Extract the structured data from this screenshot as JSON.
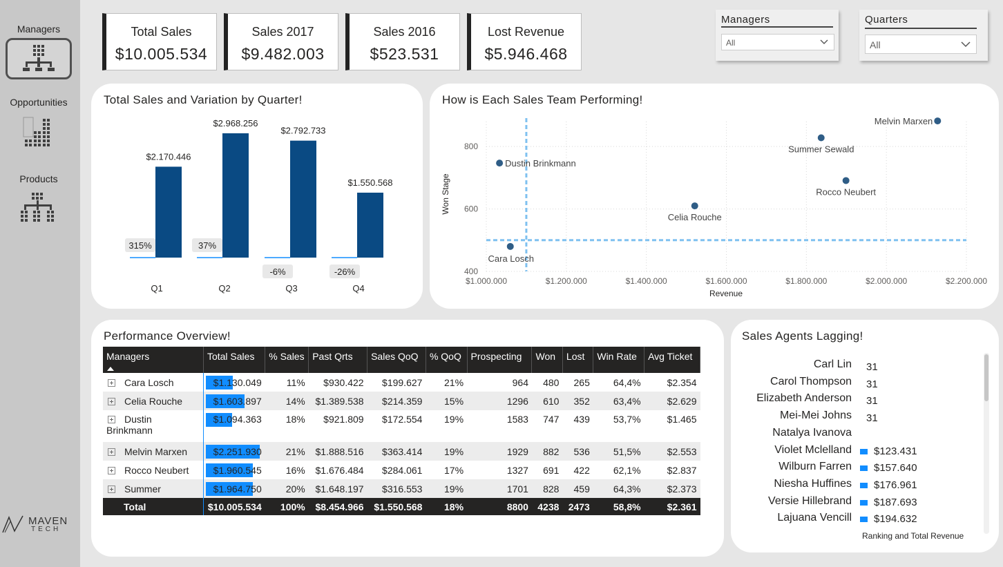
{
  "sidebar": {
    "items": [
      {
        "label": "Managers",
        "icon": "org-grid-icon",
        "active": true
      },
      {
        "label": "Opportunities",
        "icon": "bar-grid-icon",
        "active": false
      },
      {
        "label": "Products",
        "icon": "hierarchy-grid-icon",
        "active": false
      }
    ],
    "logo_text": "MAVEN",
    "logo_sub": "TECH"
  },
  "kpis": [
    {
      "title": "Total Sales",
      "value": "$10.005.534"
    },
    {
      "title": "Sales 2017",
      "value": "$9.482.003"
    },
    {
      "title": "Sales 2016",
      "value": "$523.531"
    },
    {
      "title": "Lost Revenue",
      "value": "$5.946.468"
    }
  ],
  "slicers": {
    "managers": {
      "title": "Managers",
      "value": "All"
    },
    "quarters": {
      "title": "Quarters",
      "value": "All"
    }
  },
  "colors": {
    "bar_dark": "#0a4a83",
    "accent_blue": "#118dff",
    "dot": "#2f5d86",
    "ref_line": "#7fc1f0"
  },
  "bar_panel": {
    "title": "Total Sales and Variation by Quarter!",
    "chart_data": {
      "type": "bar",
      "categories": [
        "Q1",
        "Q2",
        "Q3",
        "Q4"
      ],
      "values": [
        2170446,
        2968256,
        2792733,
        1550568
      ],
      "value_labels": [
        "$2.170.446",
        "$2.968.256",
        "$2.792.733",
        "$1.550.568"
      ],
      "variation": [
        315,
        37,
        -6,
        -26
      ],
      "variation_labels": [
        "315%",
        "37%",
        "-6%",
        "-26%"
      ],
      "ylim": [
        0,
        2968256
      ]
    }
  },
  "scatter_panel": {
    "title": "How is Each Sales Team Performing!",
    "chart_data": {
      "type": "scatter",
      "xlabel": "Revenue",
      "ylabel": "Won Stage",
      "xlim": [
        1000000,
        2200000
      ],
      "ylim": [
        400,
        880
      ],
      "x_ticks": [
        1000000,
        1200000,
        1400000,
        1600000,
        1800000,
        2000000,
        2200000
      ],
      "x_tick_labels": [
        "$1.000.000",
        "$1.200.000",
        "$1.400.000",
        "$1.600.000",
        "$1.800.000",
        "$2.000.000",
        "$2.200.000"
      ],
      "y_ticks": [
        400,
        600,
        800
      ],
      "y_tick_labels": [
        "400",
        "600",
        "800"
      ],
      "points": [
        {
          "label": "Cara Losch",
          "x": 1060000,
          "y": 480
        },
        {
          "label": "Dustin Brinkmann",
          "x": 1033000,
          "y": 747
        },
        {
          "label": "Celia Rouche",
          "x": 1521000,
          "y": 610
        },
        {
          "label": "Summer Sewald",
          "x": 1837000,
          "y": 828
        },
        {
          "label": "Rocco Neubert",
          "x": 1899000,
          "y": 691
        },
        {
          "label": "Melvin Marxen",
          "x": 2128000,
          "y": 882
        }
      ],
      "ref_x": 1100000,
      "ref_y": 500
    }
  },
  "table_panel": {
    "title": "Performance Overview!",
    "headers": [
      "Managers",
      "Total Sales",
      "% Sales",
      "Past Qrts",
      "Sales QoQ",
      "% QoQ",
      "Prospecting",
      "Won",
      "Lost",
      "Win Rate",
      "Avg Ticket"
    ],
    "max_sales": 2251930,
    "rows": [
      {
        "manager": "Cara Losch",
        "total_sales": "$1.130.049",
        "sales_num": 1130049,
        "pct_sales": "11%",
        "past_qrts": "$930.422",
        "sales_qoq": "$199.627",
        "pct_qoq": "21%",
        "prospecting": "964",
        "won": "480",
        "lost": "265",
        "win_rate": "64,4%",
        "avg_ticket": "$2.354"
      },
      {
        "manager": "Celia Rouche",
        "total_sales": "$1.603.897",
        "sales_num": 1603897,
        "pct_sales": "14%",
        "past_qrts": "$1.389.538",
        "sales_qoq": "$214.359",
        "pct_qoq": "15%",
        "prospecting": "1296",
        "won": "610",
        "lost": "352",
        "win_rate": "63,4%",
        "avg_ticket": "$2.629"
      },
      {
        "manager": "Dustin Brinkmann",
        "total_sales": "$1.094.363",
        "sales_num": 1094363,
        "pct_sales": "18%",
        "past_qrts": "$921.809",
        "sales_qoq": "$172.554",
        "pct_qoq": "19%",
        "prospecting": "1583",
        "won": "747",
        "lost": "439",
        "win_rate": "53,7%",
        "avg_ticket": "$1.465"
      },
      {
        "manager": "Melvin Marxen",
        "total_sales": "$2.251.930",
        "sales_num": 2251930,
        "pct_sales": "21%",
        "past_qrts": "$1.888.516",
        "sales_qoq": "$363.414",
        "pct_qoq": "19%",
        "prospecting": "1929",
        "won": "882",
        "lost": "536",
        "win_rate": "51,5%",
        "avg_ticket": "$2.553"
      },
      {
        "manager": "Rocco Neubert",
        "total_sales": "$1.960.545",
        "sales_num": 1960545,
        "pct_sales": "16%",
        "past_qrts": "$1.676.484",
        "sales_qoq": "$284.061",
        "pct_qoq": "17%",
        "prospecting": "1327",
        "won": "691",
        "lost": "422",
        "win_rate": "62,1%",
        "avg_ticket": "$2.837"
      },
      {
        "manager": "Summer",
        "total_sales": "$1.964.750",
        "sales_num": 1964750,
        "pct_sales": "20%",
        "past_qrts": "$1.648.197",
        "sales_qoq": "$316.553",
        "pct_qoq": "19%",
        "prospecting": "1701",
        "won": "828",
        "lost": "459",
        "win_rate": "64,3%",
        "avg_ticket": "$2.373"
      }
    ],
    "total": {
      "manager": "Total",
      "total_sales": "$10.005.534",
      "pct_sales": "100%",
      "past_qrts": "$8.454.966",
      "sales_qoq": "$1.550.568",
      "pct_qoq": "18%",
      "prospecting": "8800",
      "won": "4238",
      "lost": "2473",
      "win_rate": "58,8%",
      "avg_ticket": "$2.361"
    }
  },
  "lagging_panel": {
    "title": "Sales Agents Lagging!",
    "footer": "Ranking and Total Revenue",
    "agents": [
      {
        "name": "Carl Lin",
        "rank": "31",
        "revenue": null
      },
      {
        "name": "Carol Thompson",
        "rank": "31",
        "revenue": null
      },
      {
        "name": "Elizabeth Anderson",
        "rank": "31",
        "revenue": null
      },
      {
        "name": "Mei-Mei Johns",
        "rank": "31",
        "revenue": null
      },
      {
        "name": "Natalya Ivanova",
        "rank": null,
        "revenue": null
      },
      {
        "name": "Violet Mclelland",
        "rank": null,
        "revenue": "$123.431"
      },
      {
        "name": "Wilburn Farren",
        "rank": null,
        "revenue": "$157.640"
      },
      {
        "name": "Niesha Huffines",
        "rank": null,
        "revenue": "$176.961"
      },
      {
        "name": "Versie Hillebrand",
        "rank": null,
        "revenue": "$187.693"
      },
      {
        "name": "Lajuana Vencill",
        "rank": null,
        "revenue": "$194.632"
      }
    ]
  }
}
